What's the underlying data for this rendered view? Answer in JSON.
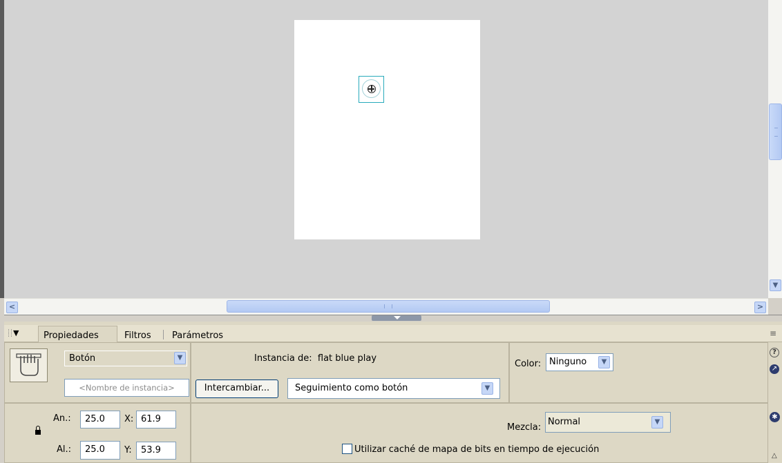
{
  "tabs": {
    "properties": "Propiedades",
    "filters": "Filtros",
    "parameters": "Parámetros"
  },
  "symbol": {
    "type": "Botón",
    "instance_name_placeholder": "<Nombre de instancia>",
    "instance_of_label": "Instancia de:",
    "instance_of_value": "flat blue play",
    "swap_button": "Intercambiar...",
    "track_mode": "Seguimiento como botón"
  },
  "color": {
    "label": "Color:",
    "value": "Ninguno"
  },
  "dimensions": {
    "width_label": "An.:",
    "width_value": "25.0",
    "height_label": "Al.:",
    "height_value": "25.0",
    "x_label": "X:",
    "x_value": "61.9",
    "y_label": "Y:",
    "y_value": "53.9"
  },
  "blend": {
    "label": "Mezcla:",
    "value": "Normal"
  },
  "cache": {
    "label": "Utilizar caché de mapa de bits en tiempo de ejecución",
    "checked": false
  },
  "icons": [
    "panel-gripper-icon",
    "collapse-arrow-icon",
    "panel-options-icon",
    "help-icon",
    "goto-icon",
    "accessibility-icon",
    "lock-icon",
    "button-symbol-icon",
    "expand-icon"
  ]
}
